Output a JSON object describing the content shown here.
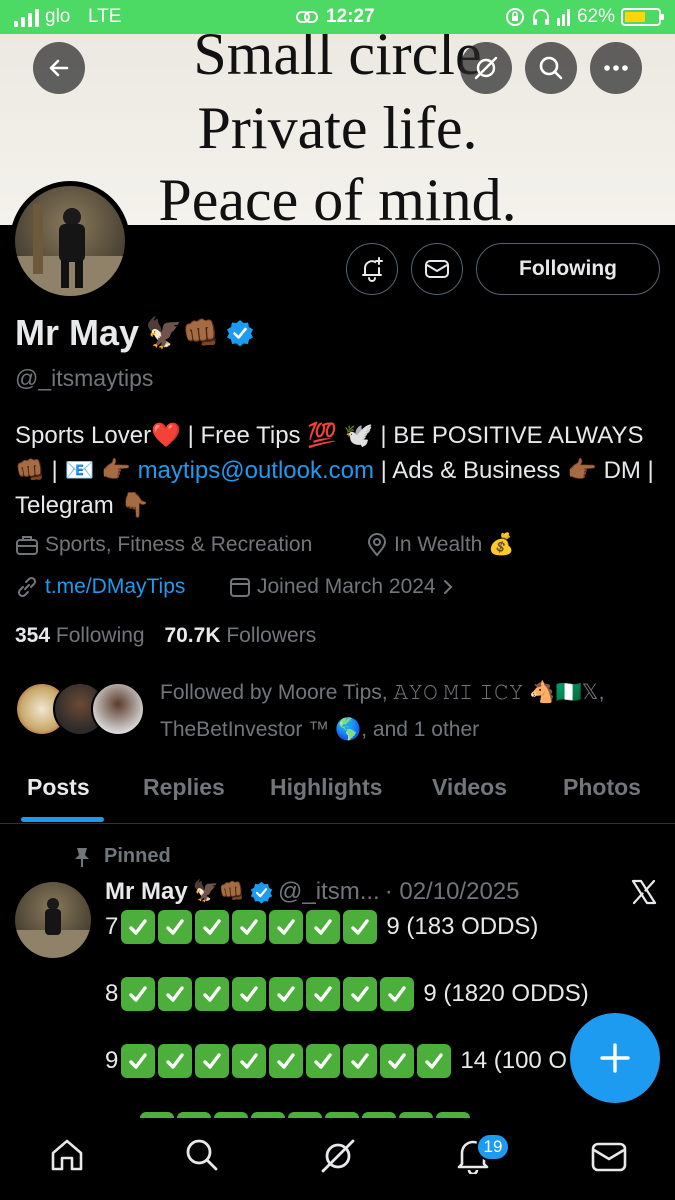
{
  "status_bar": {
    "carrier": "glo",
    "network": "LTE",
    "time": "12:27",
    "battery": "62%",
    "battery_fraction": 0.62,
    "bar_color": "#4cd964"
  },
  "banner": {
    "lines": [
      "Small circle",
      "Private life.",
      "Peace of mind."
    ]
  },
  "profile": {
    "name": "Mr May",
    "name_emoji": "🦅👊🏾",
    "handle": "@_itsmaytips",
    "bio": {
      "part1": "Sports Lover❤️ | Free Tips 💯 🕊️ | BE POSITIVE ALWAYS 👊🏾 | 📧 👉🏾 ",
      "email": "maytips@outlook.com",
      "part2": " | Ads & Business 👉🏾 DM | Telegram 👇🏾"
    },
    "category": "Sports, Fitness & Recreation",
    "location": "In Wealth 💰",
    "link": "t.me/DMayTips",
    "joined": "Joined March 2024",
    "following_count": "354",
    "following_label": "Following",
    "followers_count": "70.7K",
    "followers_label": "Followers",
    "followed_by": "Followed by Moore Tips, 𝙰𝚈𝙾 𝙼𝙸 𝙸𝙲𝚈 🐴🇳🇬𝕏, TheBetInvestor ™ 🌎, and 1 other",
    "following_button": "Following"
  },
  "tabs": [
    "Posts",
    "Replies",
    "Highlights",
    "Videos",
    "Photos"
  ],
  "pinned_post": {
    "pinned_label": "Pinned",
    "author": "Mr May",
    "author_emoji": "🦅👊🏾",
    "handle": "@_itsm...",
    "date": "· 02/10/2025",
    "lines": [
      {
        "prefix": "7",
        "checks": 7,
        "suffix": "9 (183 ODDS)"
      },
      {
        "prefix": "8",
        "checks": 8,
        "suffix": "9 (1820 ODDS)"
      },
      {
        "prefix": "9",
        "checks": 9,
        "suffix": "14 (100 O"
      }
    ]
  },
  "nav": {
    "notifications_badge": "19"
  },
  "colors": {
    "accent": "#1d9bf0",
    "muted": "#71767b",
    "check_green": "#4caf3b"
  }
}
